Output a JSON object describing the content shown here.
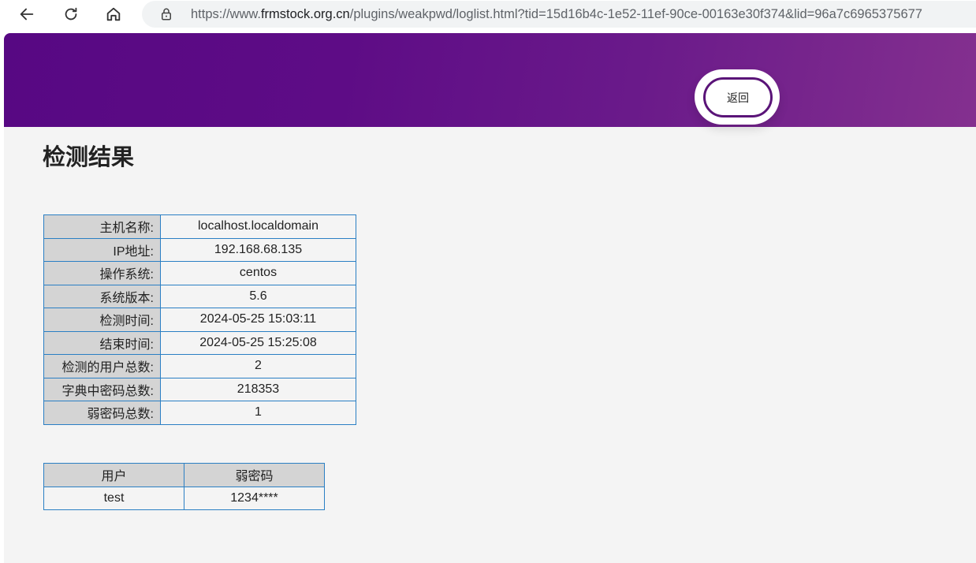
{
  "browser": {
    "url_prefix": "https://www.",
    "url_domain": "frmstock.org.cn",
    "url_path": "/plugins/weakpwd/loglist.html?tid=15d16b4c-1e52-11ef-90ce-00163e30f374&lid=96a7c6965375677"
  },
  "header": {
    "back_label": "返回"
  },
  "page": {
    "title": "检测结果"
  },
  "info": {
    "rows": [
      {
        "label": "主机名称:",
        "value": "localhost.localdomain"
      },
      {
        "label": "IP地址:",
        "value": "192.168.68.135"
      },
      {
        "label": "操作系统:",
        "value": "centos"
      },
      {
        "label": "系统版本:",
        "value": "5.6"
      },
      {
        "label": "检测时间:",
        "value": "2024-05-25 15:03:11"
      },
      {
        "label": "结束时间:",
        "value": "2024-05-25 15:25:08"
      },
      {
        "label": "检测的用户总数:",
        "value": "2"
      },
      {
        "label": "字典中密码总数:",
        "value": "218353"
      },
      {
        "label": "弱密码总数:",
        "value": "1"
      }
    ]
  },
  "results": {
    "headers": [
      "用户",
      "弱密码"
    ],
    "rows": [
      [
        "test",
        "1234****"
      ]
    ]
  },
  "colors": {
    "banner_start": "#570883",
    "banner_end": "#84308f",
    "table_border": "#2a7fc4",
    "label_bg": "#d4d4d4"
  }
}
